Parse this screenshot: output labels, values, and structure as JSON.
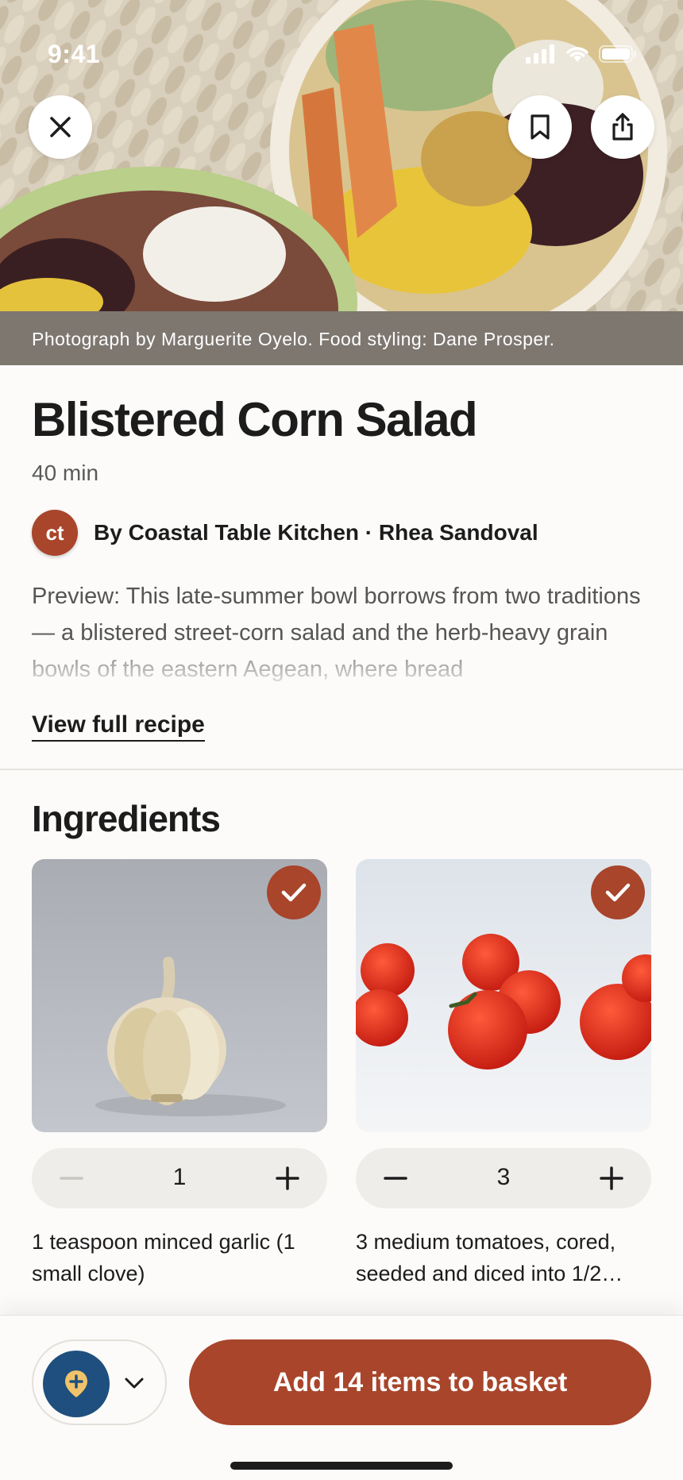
{
  "status_bar": {
    "time": "9:41"
  },
  "hero": {
    "photo_credit": "Photograph by Marguerite Oyelo. Food styling: Dane Prosper.",
    "close_icon": "close-icon",
    "bookmark_icon": "bookmark-icon",
    "share_icon": "share-icon"
  },
  "recipe": {
    "title": "Blistered Corn Salad",
    "time": "40 min",
    "author_initials": "ct",
    "author": "By Coastal Table Kitchen · Rhea Sandoval",
    "preview": "Preview: This late-summer bowl borrows from two traditions — a blistered street-corn salad and the herb-heavy grain bowls of the eastern Aegean, where bread",
    "full_recipe_link": "View full recipe"
  },
  "ingredients": {
    "heading": "Ingredients",
    "items": [
      {
        "name": "garlic",
        "quantity": "1",
        "text": "1 teaspoon minced garlic (1 small clove)",
        "selected": true,
        "minus_enabled": false
      },
      {
        "name": "tomatoes",
        "quantity": "3",
        "text": "3 medium tomatoes, cored, seeded and diced into 1/2…",
        "selected": true,
        "minus_enabled": true
      }
    ]
  },
  "bottom_bar": {
    "add_button": "Add 14 items to basket",
    "list_icon": "add-to-list-icon"
  },
  "colors": {
    "accent": "#a8452b",
    "list_badge": "#1e4f7e",
    "background": "#fcfbf9"
  }
}
